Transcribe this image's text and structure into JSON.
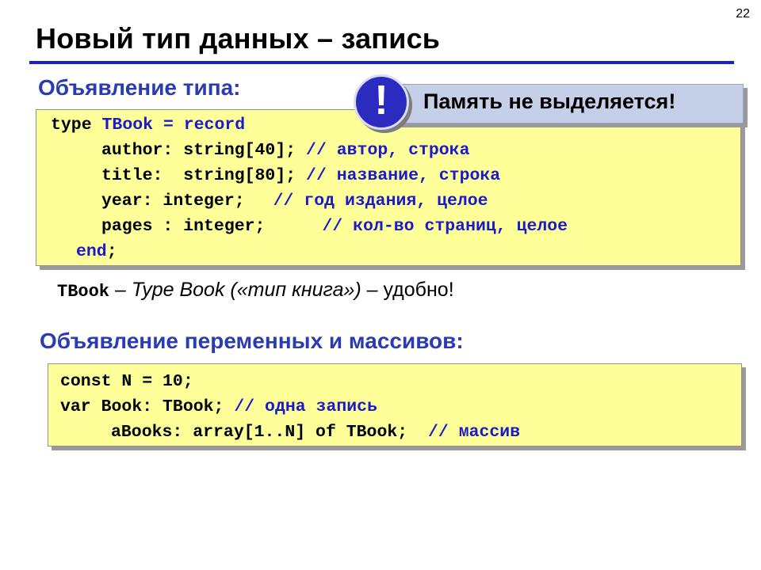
{
  "slide": {
    "number": "22",
    "title": "Новый тип данных – запись"
  },
  "sections": {
    "type_declaration_heading": "Объявление типа:",
    "variables_heading": "Объявление переменных и массивов:"
  },
  "callout": {
    "icon": "exclamation-icon",
    "icon_glyph": "!",
    "text": "Память не выделяется!"
  },
  "type_code": {
    "line1": {
      "kw": "type",
      "name": "TBook",
      "rest": "= record"
    },
    "line2": {
      "code": "author: string[40];",
      "comment": "// автор, строка"
    },
    "line3": {
      "code": "title:  string[80];",
      "comment": "// название, строка"
    },
    "line4": {
      "code": "year: integer;",
      "comment": "// год издания, целое"
    },
    "line5": {
      "code": "pages : integer;",
      "comment": "// кол-во страниц, целое"
    },
    "line6": {
      "kw": "end",
      "punct": ";"
    }
  },
  "explanation": {
    "term": "TBook",
    "dash": " – ",
    "italic": "Type Book («тип книга»)",
    "rest": " – удобно!"
  },
  "var_code": {
    "line1": "const N = 10;",
    "line2": {
      "code": "var Book: TBook;",
      "comment": "// одна запись"
    },
    "line3": {
      "code": "aBooks: array[1..N] of TBook;",
      "comment": "// массив"
    }
  },
  "colors": {
    "accent_blue": "#2b3bb4",
    "code_background": "#ffff99",
    "callout_background": "#c6cfe8"
  }
}
